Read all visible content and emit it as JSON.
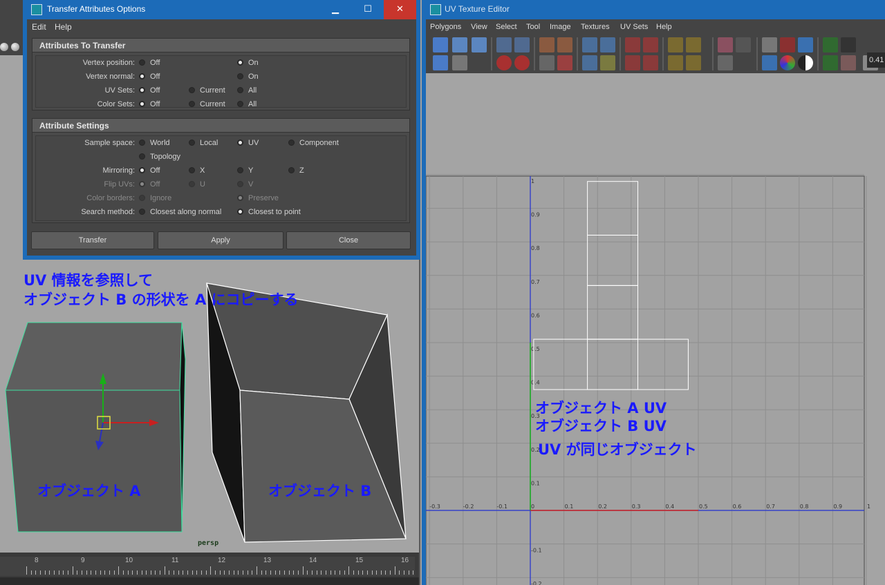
{
  "dialog": {
    "title": "Transfer Attributes Options",
    "window_buttons": {
      "minimize": "▁",
      "maximize": "☐",
      "close": "✕"
    },
    "menu": [
      "Edit",
      "Help"
    ],
    "attributes_section": {
      "header": "Attributes To Transfer",
      "rows": [
        {
          "label": "Vertex position:",
          "options": [
            "Off",
            "On"
          ],
          "selected": 1
        },
        {
          "label": "Vertex normal:",
          "options": [
            "Off",
            "On"
          ],
          "selected": 0
        },
        {
          "label": "UV Sets:",
          "options": [
            "Off",
            "Current",
            "All"
          ],
          "selected": 0
        },
        {
          "label": "Color Sets:",
          "options": [
            "Off",
            "Current",
            "All"
          ],
          "selected": 0
        }
      ]
    },
    "settings_section": {
      "header": "Attribute Settings",
      "sample_space": {
        "label": "Sample space:",
        "options": [
          "World",
          "Local",
          "UV",
          "Component",
          "Topology"
        ],
        "selected": 2
      },
      "mirroring": {
        "label": "Mirroring:",
        "options": [
          "Off",
          "X",
          "Y",
          "Z"
        ],
        "selected": 0
      },
      "flip_uvs": {
        "label": "Flip UVs:",
        "options": [
          "Off",
          "U",
          "V"
        ],
        "selected": 0
      },
      "color_borders": {
        "label": "Color borders:",
        "options": [
          "Ignore",
          "Preserve"
        ],
        "selected": 1
      },
      "search_method": {
        "label": "Search method:",
        "options": [
          "Closest along normal",
          "Closest to point"
        ],
        "selected": 1
      }
    },
    "buttons": {
      "transfer": "Transfer",
      "apply": "Apply",
      "close": "Close"
    }
  },
  "viewport": {
    "annotation_line1": "UV 情報を参照して",
    "annotation_line2": "オブジェクト B の形状を A にコピーする",
    "label_a": "オブジェクト A",
    "label_b": "オブジェクト B",
    "camera": "persp",
    "timeline_numbers": [
      "8",
      "9",
      "10",
      "11",
      "12",
      "13",
      "14",
      "15",
      "16"
    ]
  },
  "uv_editor": {
    "title": "UV Texture Editor",
    "menu": [
      "Polygons",
      "View",
      "Select",
      "Tool",
      "Image",
      "Textures",
      "UV Sets",
      "Help"
    ],
    "value_field": "0.41",
    "annotation_line1": "オブジェクト A UV",
    "annotation_line2": "オブジェクト B UV",
    "annotation_line3": "UV が同じオブジェクト",
    "v_ticks": [
      "1",
      "0.9",
      "0.8",
      "0.7",
      "0.6",
      "0.5",
      "0.4",
      "0.3",
      "0.2",
      "0.1",
      "0",
      "-0.1",
      "-0.2"
    ],
    "u_ticks": [
      "-0.3",
      "-0.2",
      "-0.1",
      "0",
      "0.1",
      "0.2",
      "0.3",
      "0.4",
      "0.5",
      "0.6",
      "0.7",
      "0.8",
      "0.9",
      "1"
    ]
  }
}
